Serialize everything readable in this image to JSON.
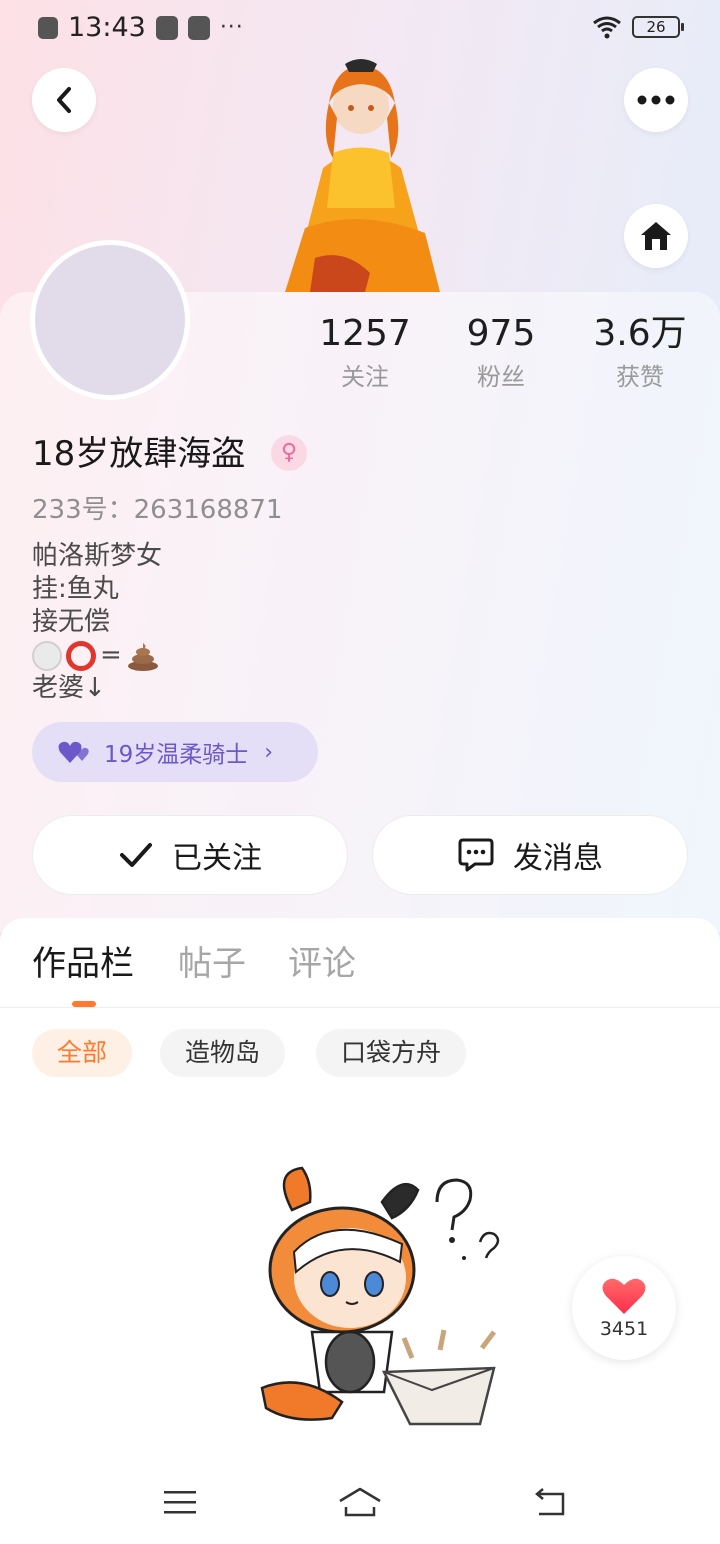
{
  "status_bar": {
    "time": "13:43",
    "dots": "···",
    "battery": "26"
  },
  "profile": {
    "name": "18岁放肆海盗",
    "gender_symbol": "♀",
    "uid": "233号：263168871",
    "stats": [
      {
        "value": "1257",
        "label": "关注"
      },
      {
        "value": "975",
        "label": "粉丝"
      },
      {
        "value": "3.6万",
        "label": "获赞"
      }
    ],
    "bio_lines": [
      "帕洛斯梦女",
      "挂:鱼丸",
      "接无偿"
    ],
    "bio_emoji_eq": "=",
    "bio_last_line": "老婆↓",
    "partner_label": "19岁温柔骑士",
    "partner_chevron": "›"
  },
  "actions": {
    "follow_label": "已关注",
    "message_label": "发消息"
  },
  "tabs": [
    {
      "label": "作品栏",
      "active": true
    },
    {
      "label": "帖子",
      "active": false
    },
    {
      "label": "评论",
      "active": false
    }
  ],
  "filters": [
    {
      "label": "全部",
      "active": true
    },
    {
      "label": "造物岛",
      "active": false
    },
    {
      "label": "口袋方舟",
      "active": false
    }
  ],
  "like_float": {
    "count": "3451"
  },
  "colors": {
    "accent": "#ff7a2e",
    "partner_purple": "#6c58c9",
    "heart": "#ff3b55",
    "pink_badge": "#f0679a"
  },
  "icons": [
    "back-arrow-icon",
    "more-dots-icon",
    "home-icon",
    "heart-icon",
    "check-icon",
    "chat-bubble-icon",
    "menu-icon",
    "nav-home-icon",
    "nav-back-icon"
  ]
}
